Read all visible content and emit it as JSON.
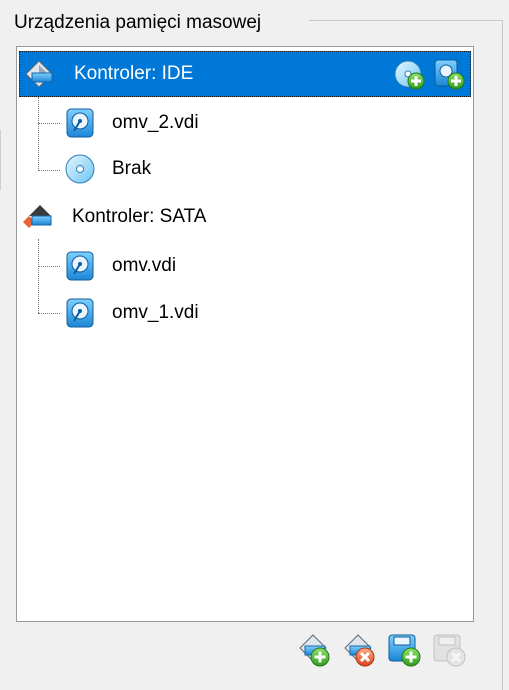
{
  "group": {
    "title": "Urządzenia pamięci masowej"
  },
  "tree": {
    "controllers": [
      {
        "label": "Kontroler: IDE",
        "icon": "ide-controller-icon",
        "selected": true,
        "attachments": [
          {
            "label": "omv_2.vdi",
            "icon": "hard-disk-icon"
          },
          {
            "label": "Brak",
            "icon": "optical-disc-icon"
          }
        ],
        "actions": [
          {
            "name": "add-optical-drive-button",
            "icon": "add-optical-drive-icon"
          },
          {
            "name": "add-hard-disk-button",
            "icon": "add-hard-disk-icon"
          }
        ]
      },
      {
        "label": "Kontroler: SATA",
        "icon": "sata-controller-icon",
        "selected": false,
        "attachments": [
          {
            "label": "omv.vdi",
            "icon": "hard-disk-icon"
          },
          {
            "label": "omv_1.vdi",
            "icon": "hard-disk-icon"
          }
        ]
      }
    ]
  },
  "toolbar": {
    "buttons": [
      {
        "name": "add-controller-button",
        "icon": "add-controller-icon",
        "enabled": true
      },
      {
        "name": "remove-controller-button",
        "icon": "remove-controller-icon",
        "enabled": true
      },
      {
        "name": "add-attachment-button",
        "icon": "add-attachment-icon",
        "enabled": true
      },
      {
        "name": "remove-attachment-button",
        "icon": "remove-attachment-icon",
        "enabled": false
      }
    ]
  },
  "colors": {
    "selection": "#0078d7",
    "panel_background": "#f0f0f0",
    "add_green": "#3fae2a",
    "remove_orange": "#e8643a",
    "disk_blue": "#1c7fd2"
  }
}
